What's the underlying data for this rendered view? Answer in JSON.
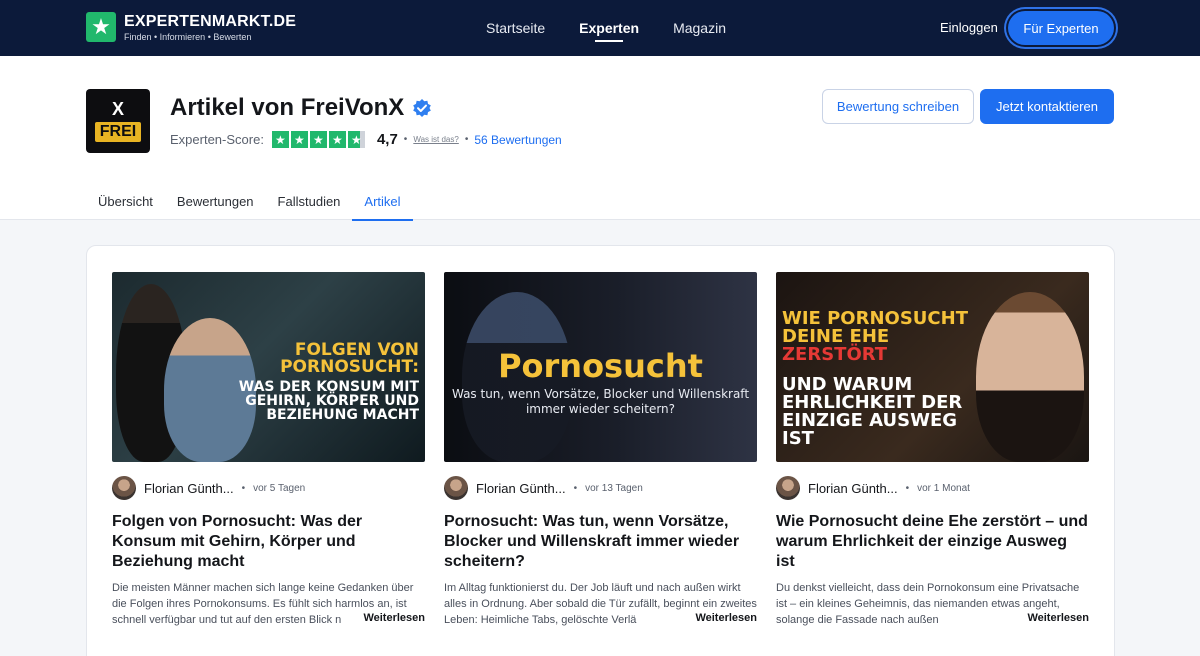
{
  "nav": {
    "logo_name": "EXPERTENMARKT.DE",
    "logo_tagline": "Finden • Informieren • Bewerten",
    "links": [
      "Startseite",
      "Experten",
      "Magazin"
    ],
    "active_link": "Experten",
    "login": "Einloggen",
    "for_experts": "Für Experten"
  },
  "profile": {
    "avatar_top": "X",
    "avatar_bottom": "FREI",
    "title": "Artikel von FreiVonX",
    "score_label": "Experten-Score:",
    "score_value": "4,7",
    "rating_fraction": 0.94,
    "what_is": "Was ist das?",
    "reviews": "56 Bewertungen",
    "btn_review": "Bewertung schreiben",
    "btn_contact": "Jetzt kontaktieren"
  },
  "tabs": [
    "Übersicht",
    "Bewertungen",
    "Fallstudien",
    "Artikel"
  ],
  "active_tab": "Artikel",
  "articles": [
    {
      "thumb_line1": "Folgen von Pornosucht:",
      "thumb_line2": "Was der Konsum mit Gehirn, Körper und Beziehung macht",
      "author": "Florian Günth...",
      "time": "vor 5 Tagen",
      "title": "Folgen von Pornosucht: Was der Konsum mit Gehirn, Körper und Beziehung macht",
      "excerpt": "Die meisten Männer machen sich lange keine Gedanken über die Folgen ihres Pornokonsums. Es fühlt sich harmlos an, ist schnell verfügbar und tut auf den ersten Blick n",
      "read_more": "Weiterlesen"
    },
    {
      "thumb_line1": "Pornosucht",
      "thumb_line2": "Was tun, wenn Vorsätze, Blocker und Willenskraft immer wieder scheitern?",
      "author": "Florian Günth...",
      "time": "vor 13 Tagen",
      "title": "Pornosucht: Was tun, wenn Vorsätze, Blocker und Willenskraft immer wieder scheitern?",
      "excerpt": "Im Alltag funktionierst du. Der Job läuft und nach außen wirkt alles in Ordnung. Aber sobald die Tür zufällt, beginnt ein zweites Leben: Heimliche Tabs, gelöschte Verlä",
      "read_more": "Weiterlesen"
    },
    {
      "thumb_line1a": "Wie Pornosucht deine Ehe ",
      "thumb_line1b": "zerstört",
      "thumb_line2": "und warum Ehrlichkeit der einzige Ausweg ist",
      "author": "Florian Günth...",
      "time": "vor 1 Monat",
      "title": "Wie Pornosucht deine Ehe zerstört – und warum Ehrlichkeit der einzige Ausweg ist",
      "excerpt": "Du denkst vielleicht, dass dein Pornokonsum eine Privatsache ist – ein kleines Geheimnis, das niemanden etwas angeht, solange die Fassade nach außen",
      "read_more": "Weiterlesen"
    }
  ],
  "icons": {
    "logo": "star-icon",
    "verified": "verified-check-icon",
    "rating_star": "star-icon"
  },
  "colors": {
    "nav_bg": "#0c1a3a",
    "accent": "#1e6ef0",
    "rating_green": "#21b86c",
    "thumb_yellow": "#f5c23a"
  }
}
